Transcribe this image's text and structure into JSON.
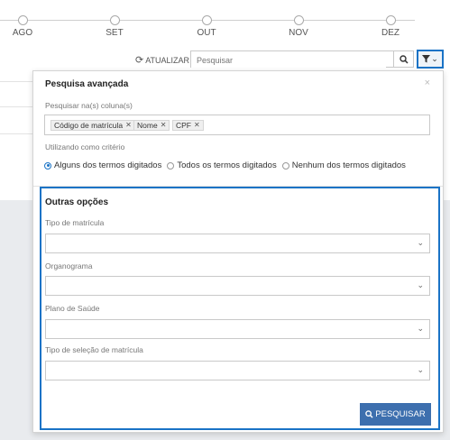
{
  "timeline": {
    "months": [
      "AGO",
      "SET",
      "OUT",
      "NOV",
      "DEZ"
    ]
  },
  "toolbar": {
    "refresh_label": "ATUALIZAR",
    "search_placeholder": "Pesquisar"
  },
  "advanced_search": {
    "title": "Pesquisa avançada",
    "columns_label": "Pesquisar na(s) coluna(s)",
    "tags": [
      "Código de matrícula",
      "Nome",
      "CPF"
    ],
    "criteria_label": "Utilizando como critério",
    "criteria": [
      {
        "label": "Alguns dos termos digitados",
        "selected": true
      },
      {
        "label": "Todos os termos digitados",
        "selected": false
      },
      {
        "label": "Nenhum dos termos digitados",
        "selected": false
      }
    ]
  },
  "other_options": {
    "title": "Outras opções",
    "fields": [
      {
        "label": "Tipo de matrícula",
        "value": ""
      },
      {
        "label": "Organograma",
        "value": ""
      },
      {
        "label": "Plano de Saúde",
        "value": ""
      },
      {
        "label": "Tipo de seleção de matrícula",
        "value": ""
      }
    ],
    "search_button": "PESQUISAR"
  },
  "colors": {
    "accent": "#1a73c6",
    "button": "#3d6fae"
  }
}
